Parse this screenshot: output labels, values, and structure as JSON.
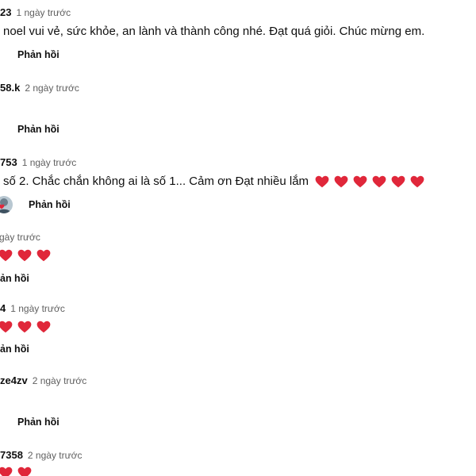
{
  "colors": {
    "heart": "#e0273a",
    "meta_gray": "#606060",
    "text": "#0f0f0f"
  },
  "comments": [
    {
      "author": "23",
      "time": "1 ngày trước",
      "text": "noel vui vẻ, sức khỏe, an lành và thành công nhé. Đạt quá giỏi. Chúc mừng em.",
      "reply": "Phản hồi"
    },
    {
      "author": "58.k",
      "time": "2 ngày trước",
      "text": "",
      "reply": "Phản hồi"
    },
    {
      "author": "753",
      "time": "1 ngày trước",
      "text": "số 2. Chắc chắn không ai là số 1... Cảm ơn Đạt nhiều lắm",
      "hearts": 6,
      "reply": "Phản hồi"
    },
    {
      "author": "",
      "time": "gày trước",
      "text": "",
      "hearts": 3,
      "reply": "ản hồi"
    },
    {
      "author": "4",
      "time": "1 ngày trước",
      "text": "",
      "hearts": 3,
      "reply": "ản hồi"
    },
    {
      "author": "ze4zv",
      "time": "2 ngày trước",
      "text": "",
      "reply": "Phản hồi"
    },
    {
      "author": "7358",
      "time": "2 ngày trước",
      "text": "",
      "hearts": 2
    }
  ]
}
